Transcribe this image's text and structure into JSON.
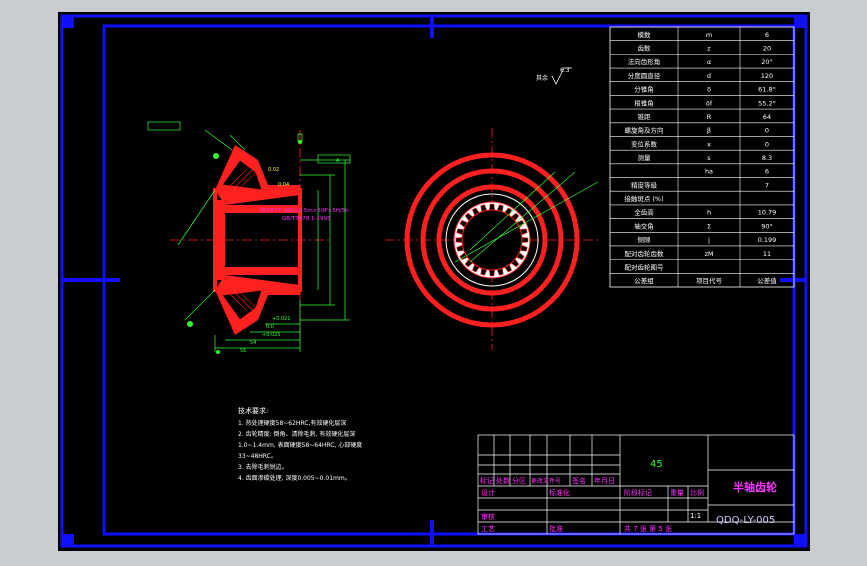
{
  "drawing": {
    "title": "半轴齿轮",
    "drawing_number": "QDQ-LY-005",
    "material": "45",
    "scale": "1:1",
    "sheet_text": "共 7 张  第 5 张",
    "title_block_labels": [
      "标记",
      "处数",
      "分区",
      "更改文件号",
      "签名",
      "年月日"
    ],
    "row_designer": "设计",
    "row_standard": "标准化",
    "row_review": "审核",
    "row_process": "工艺",
    "row_approve": "批准",
    "stage_mark": "阶段标记",
    "weight": "重量",
    "ratio": "比例",
    "colors": {
      "background": "#000000",
      "frame": "#0000ff",
      "part": "#ff0000",
      "dim": "#00ff00",
      "text": "#ffffff",
      "title": "#ff00ff"
    }
  },
  "params_table": {
    "rows": [
      {
        "name": "模数",
        "symbol": "m",
        "value": "6"
      },
      {
        "name": "齿数",
        "symbol": "z",
        "value": "20"
      },
      {
        "name": "法向齿形角",
        "symbol": "α",
        "value": "20°"
      },
      {
        "name": "分度圆直径",
        "symbol": "d",
        "value": "120"
      },
      {
        "name": "分锥角",
        "symbol": "δ",
        "value": "61.8°"
      },
      {
        "name": "根锥角",
        "symbol": "δf",
        "value": "55.2°"
      },
      {
        "name": "锥距",
        "symbol": "R",
        "value": "64"
      },
      {
        "name": "螺旋角及方向",
        "symbol": "β",
        "value": "0"
      },
      {
        "name": "变位系数",
        "symbol": "x",
        "value": "0"
      },
      {
        "name": "测量",
        "symbol": "s",
        "value": "8.3"
      },
      {
        "name": "",
        "symbol": "ha",
        "value": "6"
      },
      {
        "name": "精度等级",
        "symbol": "",
        "value": "7"
      },
      {
        "name": "接触斑点 (%)",
        "symbol": "",
        "value": ""
      },
      {
        "name": "全齿高",
        "symbol": "h",
        "value": "10.79"
      },
      {
        "name": "轴交角",
        "symbol": "Σ",
        "value": "90°"
      },
      {
        "name": "侧隙",
        "symbol": "j",
        "value": "0.199"
      },
      {
        "name": "配对齿轮齿数",
        "symbol": "zM",
        "value": "11"
      },
      {
        "name": "配对齿轮图号",
        "symbol": "",
        "value": ""
      },
      {
        "name": "公差组",
        "symbol": "项目代号",
        "value": "公差值"
      }
    ]
  },
  "tech_notes": {
    "heading": "技术要求:",
    "lines": [
      "1. 热处理硬度58~62HRC,有效硬化层深",
      "2. 齿轮精度: 倒角、清除毛刺, 有效硬化层深",
      "   1.0~1.4mm, 表面硬度58~64HRC, 心部硬度",
      "   33~48HRC。",
      "3. 去除毛刺锐边。",
      "4. 齿面渗碳处理, 深度0.005~0.01mm。"
    ]
  },
  "annotations": {
    "roughness_rest": "其余",
    "roughness_value": "6.3",
    "spline_spec": "INT/EXT 18Z×2.5m×30P×5H/5h",
    "spline_std": "GB/T3478.1-1995",
    "datum_a": "A",
    "dim_left": [
      "0.02",
      "0.04",
      "0.05",
      "0.063",
      "0.055"
    ],
    "dim_bottom": [
      "+0.021",
      "0.0",
      "+0.025",
      "54",
      "56"
    ]
  },
  "window": {
    "cad_area": "drawing-canvas"
  }
}
